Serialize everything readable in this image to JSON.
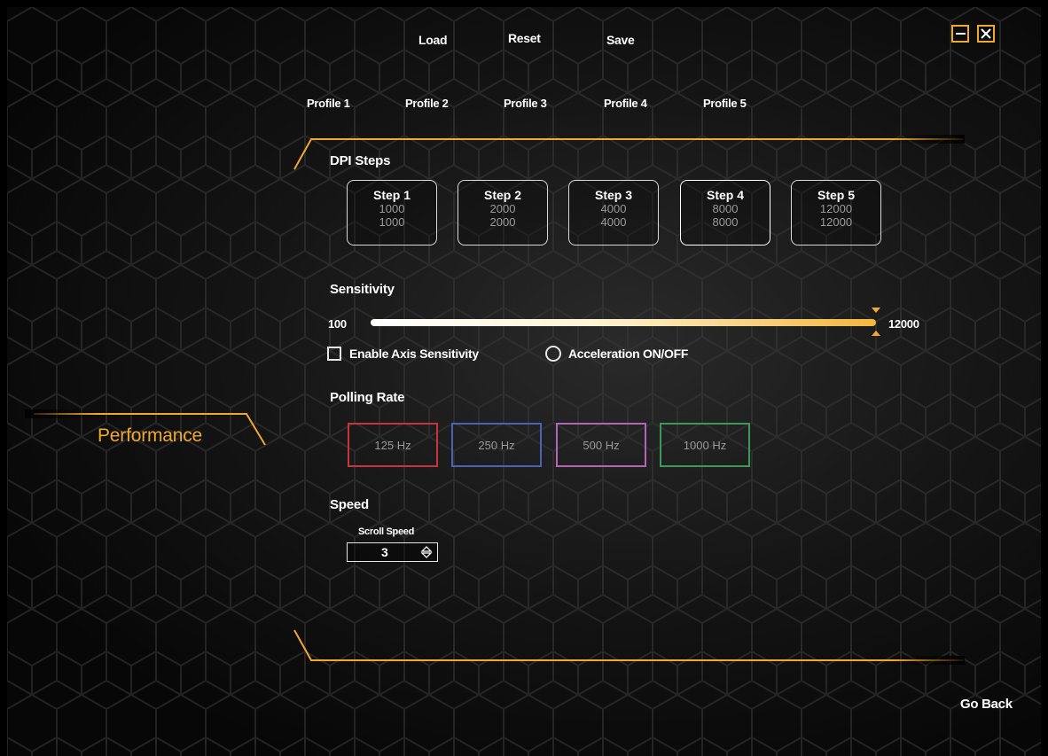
{
  "toolbar": {
    "load": "Load",
    "reset": "Reset",
    "save": "Save"
  },
  "window": {
    "minimize_icon": "minimize-icon",
    "close_icon": "close-icon"
  },
  "profiles": [
    "Profile 1",
    "Profile 2",
    "Profile 3",
    "Profile 4",
    "Profile 5"
  ],
  "side_nav": {
    "active": "Performance"
  },
  "dpi": {
    "title": "DPI Steps",
    "steps": [
      {
        "label": "Step 1",
        "x": "1000",
        "y": "1000"
      },
      {
        "label": "Step 2",
        "x": "2000",
        "y": "2000"
      },
      {
        "label": "Step 3",
        "x": "4000",
        "y": "4000"
      },
      {
        "label": "Step 4",
        "x": "8000",
        "y": "8000"
      },
      {
        "label": "Step 5",
        "x": "12000",
        "y": "12000"
      }
    ],
    "selected_step": "Step 4"
  },
  "sensitivity": {
    "title": "Sensitivity",
    "min_label": "100",
    "max_label": "12000",
    "min": 100,
    "max": 12000,
    "value": 12000,
    "axis_checkbox_label": "Enable Axis Sensitivity",
    "acceleration_label": "Acceleration ON/OFF"
  },
  "polling": {
    "title": "Polling Rate",
    "options": [
      {
        "label": "125 Hz",
        "color": "#c8343c"
      },
      {
        "label": "250 Hz",
        "color": "#4a63b8"
      },
      {
        "label": "500 Hz",
        "color": "#b565b8"
      },
      {
        "label": "1000 Hz",
        "color": "#3b9a55"
      }
    ]
  },
  "speed": {
    "title": "Speed",
    "scroll_label": "Scroll Speed",
    "scroll_value": "3"
  },
  "footer": {
    "go_back": "Go Back"
  },
  "colors": {
    "accent": "#f0a92b",
    "background": "#0d0d0d"
  }
}
